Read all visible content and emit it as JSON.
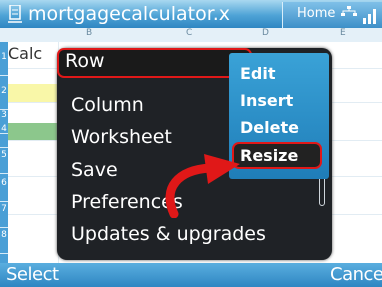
{
  "titlebar": {
    "title": "mortgagecalculator.x",
    "home_label": "Home",
    "icons": [
      "spreadsheet-app-icon",
      "network-icon",
      "signal-icon"
    ]
  },
  "sheet": {
    "column_headers": [
      "B",
      "C",
      "D",
      "E"
    ],
    "row_headers": [
      "1",
      "2",
      "3",
      "4",
      "5",
      "6",
      "7",
      "8"
    ],
    "cell_text": "Calc"
  },
  "menu": {
    "items": [
      "Row",
      "Column",
      "Worksheet",
      "Save",
      "Preferences",
      "Updates & upgrades"
    ],
    "selected": "Row"
  },
  "submenu": {
    "items": [
      "Edit",
      "Insert",
      "Delete",
      "Resize"
    ],
    "selected": "Resize"
  },
  "softkeys": {
    "left": "Select",
    "right": "Cancel"
  },
  "colors": {
    "accent": "#2e86c2",
    "highlight_border": "#e01818",
    "menu_bg": "#1f2226"
  }
}
